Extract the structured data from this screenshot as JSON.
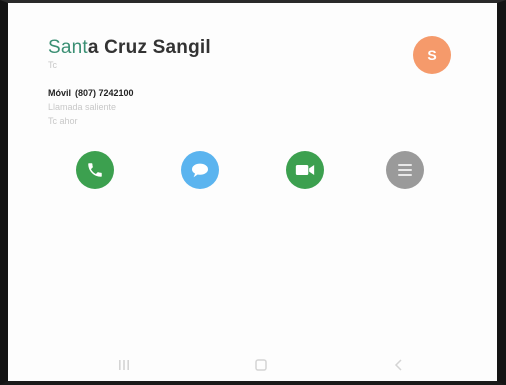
{
  "contact": {
    "name_highlight": "Sant",
    "name_rest": "a Cruz Sangil",
    "subtitle": "Tc",
    "avatar_letter": "S"
  },
  "phone": {
    "type": "Móvil",
    "number": "(807) 7242100"
  },
  "status": {
    "line1": "Llamada saliente",
    "line2": "Tc ahor"
  },
  "actions": [
    {
      "label": "call",
      "icon": "phone-icon",
      "color": "#3ca04f"
    },
    {
      "label": "message",
      "icon": "message-icon",
      "color": "#5bb4ef"
    },
    {
      "label": "video-call",
      "icon": "video-icon",
      "color": "#3ca04f"
    },
    {
      "label": "more",
      "icon": "menu-icon",
      "color": "#9a9a9a"
    }
  ],
  "navbar": {
    "items": [
      {
        "icon": "recent-apps-icon"
      },
      {
        "icon": "home-icon"
      },
      {
        "icon": "back-icon"
      }
    ]
  },
  "colors": {
    "avatar": "#f59a6b",
    "highlight": "#3a8f73"
  }
}
